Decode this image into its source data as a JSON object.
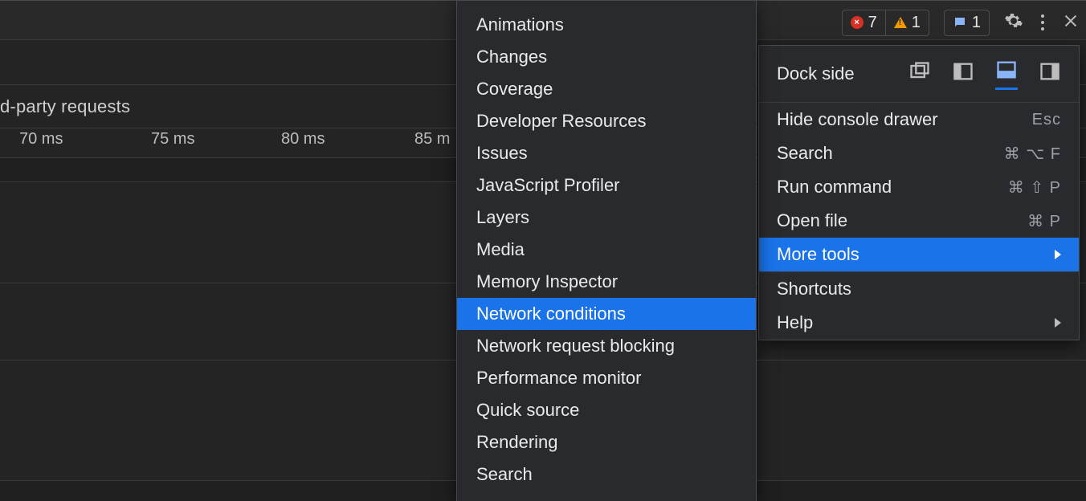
{
  "bg": {
    "third_party_label": "d-party requests",
    "timeline": {
      "t0": "70 ms",
      "t1": "75 ms",
      "t2": "80 ms",
      "t3": "85 m"
    }
  },
  "toolbar": {
    "errors_count": "7",
    "warnings_count": "1",
    "messages_count": "1"
  },
  "menu": {
    "dock_label": "Dock side",
    "hide_drawer": "Hide console drawer",
    "hide_drawer_short": "Esc",
    "search": "Search",
    "search_short": "⌘ ⌥ F",
    "run_cmd": "Run command",
    "run_cmd_short": "⌘ ⇧ P",
    "open_file": "Open file",
    "open_file_short": "⌘ P",
    "more_tools": "More tools",
    "shortcuts": "Shortcuts",
    "help": "Help"
  },
  "submenu": {
    "items": [
      "Animations",
      "Changes",
      "Coverage",
      "Developer Resources",
      "Issues",
      "JavaScript Profiler",
      "Layers",
      "Media",
      "Memory Inspector",
      "Network conditions",
      "Network request blocking",
      "Performance monitor",
      "Quick source",
      "Rendering",
      "Search"
    ],
    "highlighted_index": 9
  }
}
